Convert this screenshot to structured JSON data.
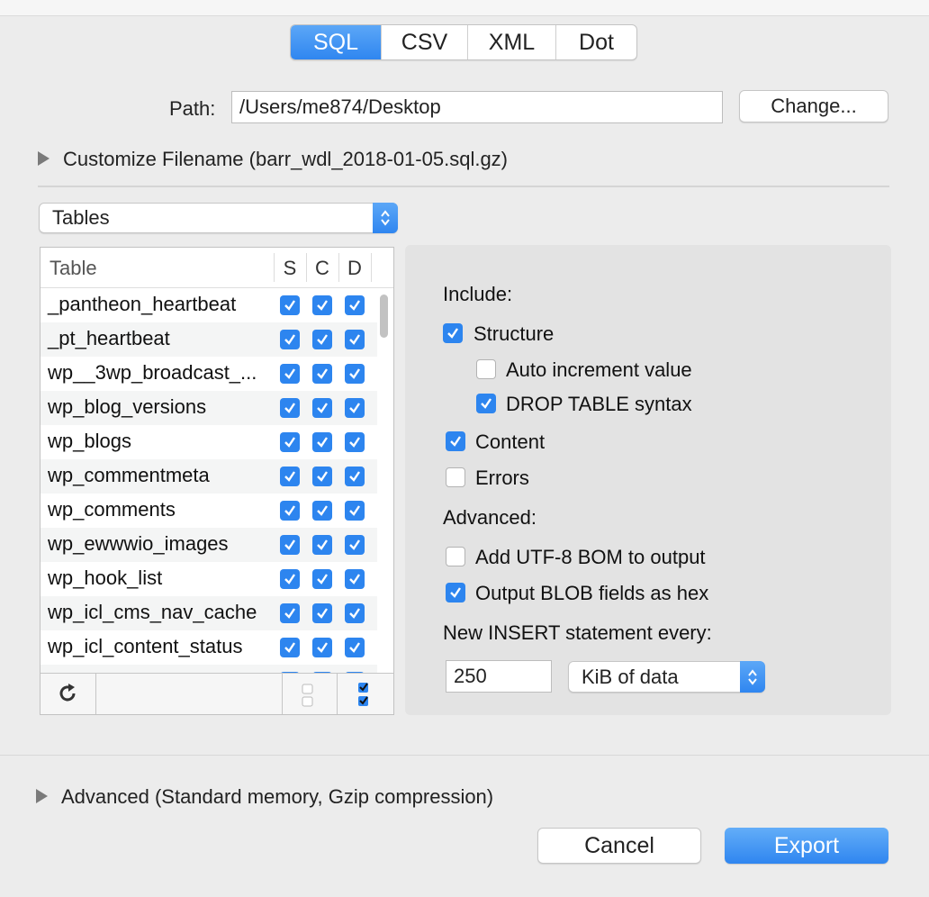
{
  "format_tabs": [
    {
      "label": "SQL",
      "active": true
    },
    {
      "label": "CSV",
      "active": false
    },
    {
      "label": "XML",
      "active": false
    },
    {
      "label": "Dot",
      "active": false
    }
  ],
  "path": {
    "label": "Path:",
    "value": "/Users/me874/Desktop",
    "change_button": "Change..."
  },
  "customize_filename": "Customize Filename (barr_wdl_2018-01-05.sql.gz)",
  "tables_popup": "Tables",
  "table": {
    "headers": {
      "name": "Table",
      "s": "S",
      "c": "C",
      "d": "D"
    },
    "rows": [
      {
        "name": "_pantheon_heartbeat",
        "s": true,
        "c": true,
        "d": true
      },
      {
        "name": "_pt_heartbeat",
        "s": true,
        "c": true,
        "d": true
      },
      {
        "name": "wp__3wp_broadcast_...",
        "s": true,
        "c": true,
        "d": true
      },
      {
        "name": "wp_blog_versions",
        "s": true,
        "c": true,
        "d": true
      },
      {
        "name": "wp_blogs",
        "s": true,
        "c": true,
        "d": true
      },
      {
        "name": "wp_commentmeta",
        "s": true,
        "c": true,
        "d": true
      },
      {
        "name": "wp_comments",
        "s": true,
        "c": true,
        "d": true
      },
      {
        "name": "wp_ewwwio_images",
        "s": true,
        "c": true,
        "d": true
      },
      {
        "name": "wp_hook_list",
        "s": true,
        "c": true,
        "d": true
      },
      {
        "name": "wp_icl_cms_nav_cache",
        "s": true,
        "c": true,
        "d": true
      },
      {
        "name": "wp_icl_content_status",
        "s": true,
        "c": true,
        "d": true
      }
    ]
  },
  "options": {
    "include_label": "Include:",
    "structure": {
      "label": "Structure",
      "checked": true
    },
    "auto_increment": {
      "label": "Auto increment value",
      "checked": false
    },
    "drop_table": {
      "label": "DROP TABLE syntax",
      "checked": true
    },
    "content": {
      "label": "Content",
      "checked": true
    },
    "errors": {
      "label": "Errors",
      "checked": false
    },
    "advanced_label": "Advanced:",
    "utf8_bom": {
      "label": "Add UTF-8 BOM to output",
      "checked": false
    },
    "blob_hex": {
      "label": "Output BLOB fields as hex",
      "checked": true
    },
    "insert_label": "New INSERT statement every:",
    "insert_value": "250",
    "insert_unit": "KiB of data"
  },
  "advanced_disclosure": "Advanced (Standard memory, Gzip compression)",
  "buttons": {
    "cancel": "Cancel",
    "export": "Export"
  },
  "colors": {
    "accent": "#2f86f0",
    "checkbox": "#2d85ef"
  }
}
